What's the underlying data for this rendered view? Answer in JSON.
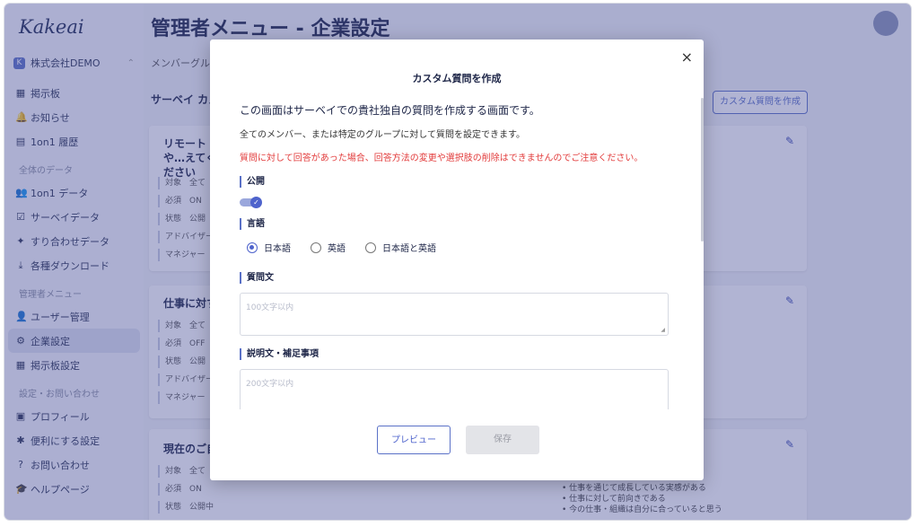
{
  "sidebar": {
    "logo": "Kakeai",
    "company": "株式会社DEMO",
    "items_top": [
      {
        "icon": "▦",
        "label": "掲示板"
      },
      {
        "icon": "🔔",
        "label": "お知らせ"
      },
      {
        "icon": "▤",
        "label": "1on1 履歴"
      }
    ],
    "section_data": "全体のデータ",
    "items_data": [
      {
        "icon": "👥",
        "label": "1on1 データ"
      },
      {
        "icon": "☑",
        "label": "サーベイデータ"
      },
      {
        "icon": "✦",
        "label": "すり合わせデータ"
      },
      {
        "icon": "⤓",
        "label": "各種ダウンロード"
      }
    ],
    "section_admin": "管理者メニュー",
    "items_admin": [
      {
        "icon": "👤",
        "label": "ユーザー管理"
      },
      {
        "icon": "⚙",
        "label": "企業設定"
      },
      {
        "icon": "▦",
        "label": "掲示板設定"
      }
    ],
    "section_settings": "設定・お問い合わせ",
    "items_settings": [
      {
        "icon": "▣",
        "label": "プロフィール"
      },
      {
        "icon": "✱",
        "label": "便利にする設定"
      },
      {
        "icon": "?",
        "label": "お問い合わせ"
      },
      {
        "icon": "🎓",
        "label": "ヘルプページ"
      }
    ]
  },
  "header": {
    "title": "管理者メニュー - 企業設定",
    "breadcrumb": "メンバーグルー",
    "survey_label": "サーベイ カスタ",
    "create_button": "カスタム質問を作成"
  },
  "cards": [
    {
      "title": "リモートや…えてください",
      "meta": [
        "対象　全て",
        "必須　ON",
        "状態　公開",
        "アドバイザー",
        "マネジャー"
      ]
    },
    {
      "title": "仕事に対す",
      "meta": [
        "対象　全て",
        "必須　OFF",
        "状態　公開",
        "アドバイザー",
        "マネジャー"
      ]
    },
    {
      "title": "現在のご自",
      "meta": [
        "対象　全て",
        "必須　ON",
        "状態　公開中"
      ],
      "bullets": [
        "• 仕事を通じて成長している実感がある",
        "• 仕事に対して前向きである",
        "• 今の仕事・組織は自分に合っていると思う"
      ]
    }
  ],
  "modal": {
    "close": "×",
    "title": "カスタム質問を作成",
    "intro": "この画面はサーベイでの貴社独自の質問を作成する画面です。",
    "sub": "全てのメンバー、または特定のグループに対して質問を設定できます。",
    "warning": "質問に対して回答があった場合、回答方法の変更や選択肢の削除はできませんのでご注意ください。",
    "publish_label": "公開",
    "publish_on": true,
    "language_label": "言語",
    "languages": [
      "日本語",
      "英語",
      "日本語と英語"
    ],
    "selected_language": "日本語",
    "question_label": "質問文",
    "question_placeholder": "100文字以内",
    "desc_label": "説明文・補足事項",
    "desc_placeholder": "200文字以内",
    "preview_button": "プレビュー",
    "save_button": "保存"
  }
}
